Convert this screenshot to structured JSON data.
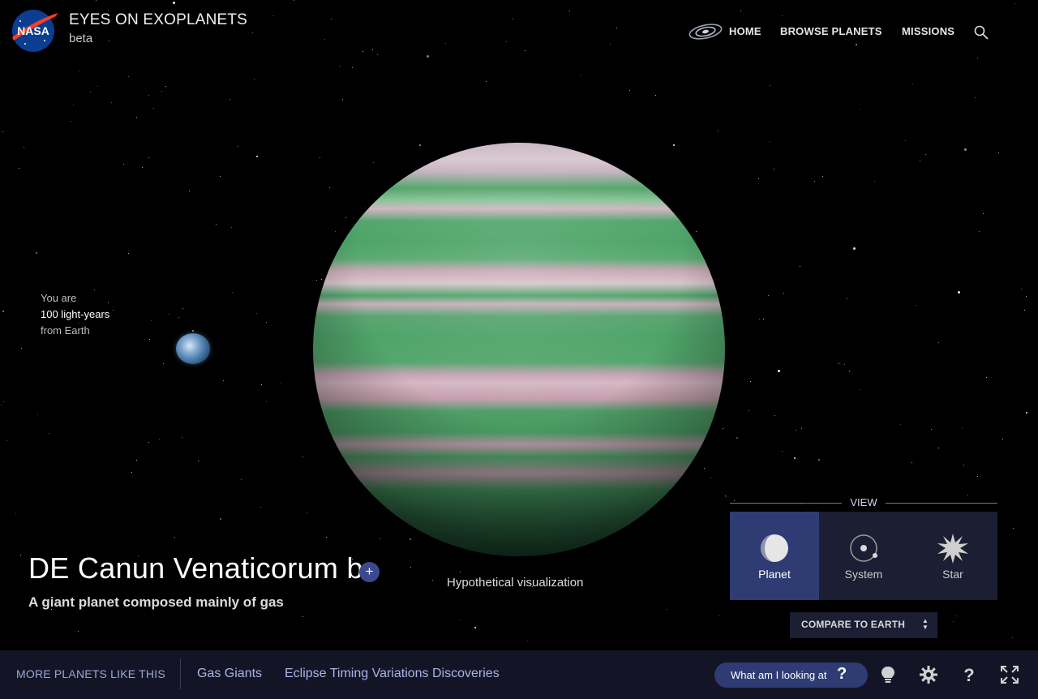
{
  "header": {
    "logo_text": "NASA",
    "app_title": "EYES ON EXOPLANETS",
    "app_subtitle": "beta",
    "nav": [
      {
        "label": "HOME",
        "icon": "galaxy-icon"
      },
      {
        "label": "BROWSE PLANETS"
      },
      {
        "label": "MISSIONS"
      }
    ],
    "search_icon": "search-icon"
  },
  "distance": {
    "line1": "You are",
    "line2": "100 light-years",
    "line3": "from Earth"
  },
  "planet": {
    "name": "DE Canun Venaticorum b",
    "description": "A giant planet composed mainly of gas",
    "caption": "Hypothetical visualization",
    "add_icon": "plus-icon"
  },
  "view_panel": {
    "label": "VIEW",
    "options": [
      {
        "label": "Planet",
        "icon": "planet-icon",
        "active": true
      },
      {
        "label": "System",
        "icon": "system-icon",
        "active": false
      },
      {
        "label": "Star",
        "icon": "star-icon",
        "active": false
      }
    ],
    "compare_label": "COMPARE TO EARTH"
  },
  "bottom_bar": {
    "more_label": "MORE PLANETS LIKE THIS",
    "tags": [
      "Gas Giants",
      "Eclipse Timing Variations Discoveries"
    ],
    "what_label": "What am I looking at",
    "what_icon": "?",
    "icons": [
      "lightbulb-icon",
      "gear-icon",
      "help-icon",
      "fullscreen-icon"
    ]
  },
  "colors": {
    "accent": "#2f3b73",
    "panel": "#1c1f33",
    "bottom_bar": "#131526",
    "link": "#a9b4e6"
  }
}
